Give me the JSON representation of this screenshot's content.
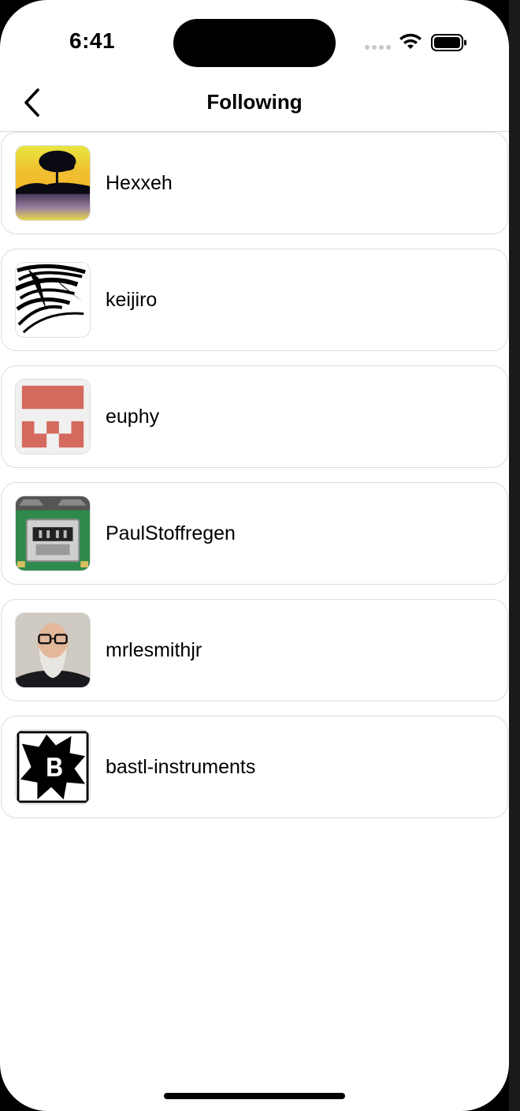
{
  "status_bar": {
    "time": "6:41",
    "icons": [
      "signal-dots-icon",
      "wifi-icon",
      "battery-icon"
    ]
  },
  "nav": {
    "title": "Following",
    "back_icon": "chevron-left-icon"
  },
  "users": [
    {
      "username": "Hexxeh",
      "avatar": "tree-sunset-avatar"
    },
    {
      "username": "keijiro",
      "avatar": "ink-scribble-avatar"
    },
    {
      "username": "euphy",
      "avatar": "pixel-pattern-avatar"
    },
    {
      "username": "PaulStoffregen",
      "avatar": "usb-connector-photo-avatar"
    },
    {
      "username": "mrlesmithjr",
      "avatar": "person-photo-avatar"
    },
    {
      "username": "bastl-instruments",
      "avatar": "bastl-logo-avatar"
    }
  ],
  "colors": {
    "background": "#ffffff",
    "border": "#dcdcdc",
    "euphy_pattern": "#d4695e",
    "text": "#000000"
  }
}
